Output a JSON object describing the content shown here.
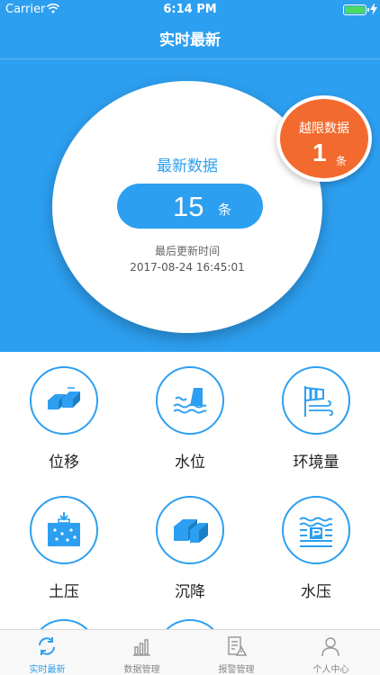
{
  "status_bar": {
    "carrier": "Carrier",
    "time": "6:14 PM"
  },
  "nav": {
    "title": "实时最新"
  },
  "summary": {
    "latest_label": "最新数据",
    "latest_count": "15",
    "unit": "条",
    "update_label": "最后更新时间",
    "update_time": "2017-08-24 16:45:01"
  },
  "over_limit": {
    "label": "越限数据",
    "count": "1",
    "unit": "条"
  },
  "grid": [
    {
      "label": "位移",
      "icon": "displacement-icon"
    },
    {
      "label": "水位",
      "icon": "water-level-icon"
    },
    {
      "label": "环境量",
      "icon": "environment-icon"
    },
    {
      "label": "土压",
      "icon": "soil-pressure-icon"
    },
    {
      "label": "沉降",
      "icon": "settlement-icon"
    },
    {
      "label": "水压",
      "icon": "water-pressure-icon"
    }
  ],
  "tabs": [
    {
      "label": "实时最新",
      "icon": "refresh-icon",
      "active": true
    },
    {
      "label": "数据管理",
      "icon": "bar-chart-icon",
      "active": false
    },
    {
      "label": "报警管理",
      "icon": "alarm-doc-icon",
      "active": false
    },
    {
      "label": "个人中心",
      "icon": "user-icon",
      "active": false
    }
  ],
  "colors": {
    "primary": "#2d9ff0",
    "alert": "#f26a2e"
  }
}
